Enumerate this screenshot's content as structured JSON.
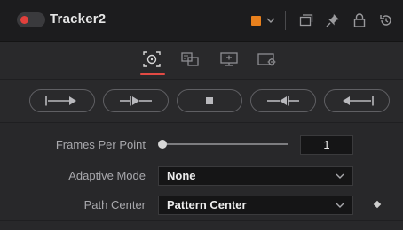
{
  "header": {
    "title": "Tracker2",
    "color_swatch": "#e8801d",
    "icons": [
      "color-dropdown-chevron-icon",
      "window-icon",
      "pin-icon",
      "lock-icon",
      "reset-icon"
    ]
  },
  "tabs": [
    {
      "icon": "tracker-target-icon",
      "active": true
    },
    {
      "icon": "operation-icon",
      "active": false
    },
    {
      "icon": "display-icon",
      "active": false
    },
    {
      "icon": "settings-icon",
      "active": false
    }
  ],
  "transport": [
    "track-reverse-icon",
    "track-one-frame-reverse-icon",
    "stop-icon",
    "track-one-frame-forward-icon",
    "track-forward-icon"
  ],
  "controls": {
    "frames_per_point": {
      "label": "Frames Per Point",
      "value": "1",
      "slider_fraction": 0.0
    },
    "adaptive_mode": {
      "label": "Adaptive Mode",
      "value": "None"
    },
    "path_center": {
      "label": "Path Center",
      "value": "Pattern Center"
    }
  },
  "colors": {
    "accent": "#e24a44",
    "panel": "#28282a",
    "header": "#1c1c1e"
  }
}
